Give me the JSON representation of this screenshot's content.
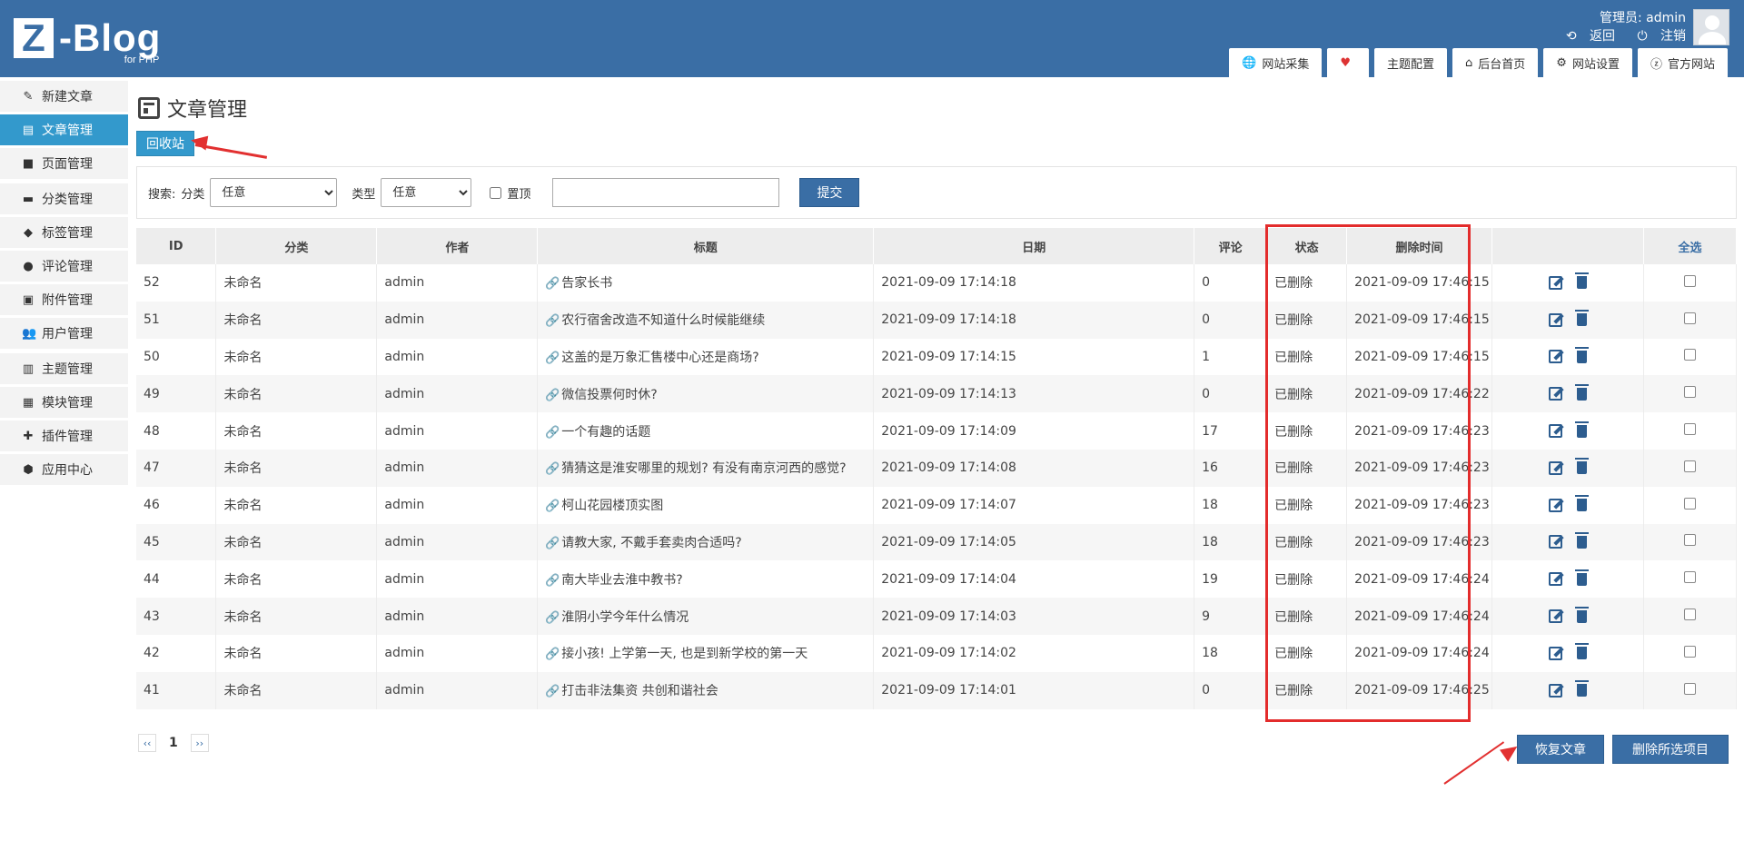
{
  "logo": {
    "letter": "Z",
    "name": "-Blog",
    "sub": "for PHP"
  },
  "user": {
    "label": "管理员: admin",
    "back": "返回",
    "logout": "注销"
  },
  "topmenu": [
    {
      "label": "网站采集",
      "icon": "globe-icon"
    },
    {
      "label": "",
      "icon": "palette-icon"
    },
    {
      "label": "主题配置",
      "icon": ""
    },
    {
      "label": "后台首页",
      "icon": "home-icon"
    },
    {
      "label": "网站设置",
      "icon": "gear-icon"
    },
    {
      "label": "官方网站",
      "icon": "zblog-icon"
    }
  ],
  "sidebar": [
    {
      "label": "新建文章",
      "icon": "edit-icon"
    },
    {
      "label": "文章管理",
      "icon": "article-icon"
    },
    {
      "label": "页面管理",
      "icon": "page-icon"
    },
    {
      "label": "分类管理",
      "icon": "folder-icon"
    },
    {
      "label": "标签管理",
      "icon": "tag-icon"
    },
    {
      "label": "评论管理",
      "icon": "comment-icon"
    },
    {
      "label": "附件管理",
      "icon": "attachment-icon"
    },
    {
      "label": "用户管理",
      "icon": "users-icon"
    },
    {
      "label": "主题管理",
      "icon": "theme-icon"
    },
    {
      "label": "模块管理",
      "icon": "grid-icon"
    },
    {
      "label": "插件管理",
      "icon": "puzzle-icon"
    },
    {
      "label": "应用中心",
      "icon": "box-icon"
    }
  ],
  "page": {
    "title": "文章管理",
    "recycle": "回收站"
  },
  "search": {
    "label": "搜索:",
    "category_label": "分类",
    "category_value": "任意",
    "type_label": "类型",
    "type_value": "任意",
    "top_label": "置顶",
    "submit": "提交"
  },
  "table": {
    "headers": [
      "ID",
      "分类",
      "作者",
      "标题",
      "日期",
      "评论",
      "状态",
      "删除时间",
      "",
      "全选"
    ],
    "rows": [
      {
        "id": "52",
        "cat": "未命名",
        "author": "admin",
        "title": "告家长书",
        "date": "2021-09-09 17:14:18",
        "comments": "0",
        "status": "已删除",
        "deleted": "2021-09-09 17:46:15"
      },
      {
        "id": "51",
        "cat": "未命名",
        "author": "admin",
        "title": "农行宿舍改造不知道什么时候能继续",
        "date": "2021-09-09 17:14:18",
        "comments": "0",
        "status": "已删除",
        "deleted": "2021-09-09 17:46:15"
      },
      {
        "id": "50",
        "cat": "未命名",
        "author": "admin",
        "title": "这盖的是万象汇售楼中心还是商场?",
        "date": "2021-09-09 17:14:15",
        "comments": "1",
        "status": "已删除",
        "deleted": "2021-09-09 17:46:15"
      },
      {
        "id": "49",
        "cat": "未命名",
        "author": "admin",
        "title": "微信投票何时休?",
        "date": "2021-09-09 17:14:13",
        "comments": "0",
        "status": "已删除",
        "deleted": "2021-09-09 17:46:22"
      },
      {
        "id": "48",
        "cat": "未命名",
        "author": "admin",
        "title": "一个有趣的话题",
        "date": "2021-09-09 17:14:09",
        "comments": "17",
        "status": "已删除",
        "deleted": "2021-09-09 17:46:23"
      },
      {
        "id": "47",
        "cat": "未命名",
        "author": "admin",
        "title": "猜猜这是淮安哪里的规划? 有没有南京河西的感觉?",
        "date": "2021-09-09 17:14:08",
        "comments": "16",
        "status": "已删除",
        "deleted": "2021-09-09 17:46:23"
      },
      {
        "id": "46",
        "cat": "未命名",
        "author": "admin",
        "title": "柯山花园楼顶实图",
        "date": "2021-09-09 17:14:07",
        "comments": "18",
        "status": "已删除",
        "deleted": "2021-09-09 17:46:23"
      },
      {
        "id": "45",
        "cat": "未命名",
        "author": "admin",
        "title": "请教大家, 不戴手套卖肉合适吗?",
        "date": "2021-09-09 17:14:05",
        "comments": "18",
        "status": "已删除",
        "deleted": "2021-09-09 17:46:23"
      },
      {
        "id": "44",
        "cat": "未命名",
        "author": "admin",
        "title": "南大毕业去淮中教书?",
        "date": "2021-09-09 17:14:04",
        "comments": "19",
        "status": "已删除",
        "deleted": "2021-09-09 17:46:24"
      },
      {
        "id": "43",
        "cat": "未命名",
        "author": "admin",
        "title": "淮阴小学今年什么情况",
        "date": "2021-09-09 17:14:03",
        "comments": "9",
        "status": "已删除",
        "deleted": "2021-09-09 17:46:24"
      },
      {
        "id": "42",
        "cat": "未命名",
        "author": "admin",
        "title": "接小孩! 上学第一天, 也是到新学校的第一天",
        "date": "2021-09-09 17:14:02",
        "comments": "18",
        "status": "已删除",
        "deleted": "2021-09-09 17:46:24"
      },
      {
        "id": "41",
        "cat": "未命名",
        "author": "admin",
        "title": "打击非法集资 共创和谐社会",
        "date": "2021-09-09 17:14:01",
        "comments": "0",
        "status": "已删除",
        "deleted": "2021-09-09 17:46:25"
      }
    ]
  },
  "pager": {
    "prev": "‹‹",
    "current": "1",
    "next": "››"
  },
  "actions": {
    "restore": "恢复文章",
    "delete_selected": "删除所选项目"
  },
  "colors": {
    "header": "#3a6ea5",
    "active": "#3399cc",
    "annotation": "#e32c2c"
  }
}
